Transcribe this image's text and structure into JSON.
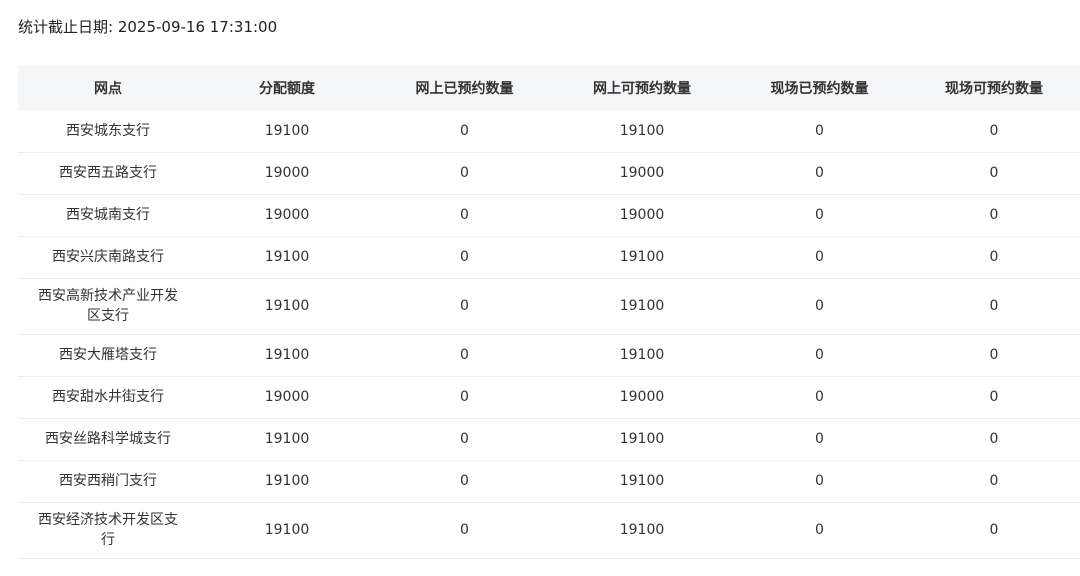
{
  "stat_date_label": "统计截止日期: 2025-09-16 17:31:00",
  "table": {
    "headers": [
      "网点",
      "分配额度",
      "网上已预约数量",
      "网上可预约数量",
      "现场已预约数量",
      "现场可预约数量"
    ],
    "rows": [
      {
        "branch": "西安城东支行",
        "quota": "19100",
        "online_booked": "0",
        "online_available": "19100",
        "onsite_booked": "0",
        "onsite_available": "0"
      },
      {
        "branch": "西安西五路支行",
        "quota": "19000",
        "online_booked": "0",
        "online_available": "19000",
        "onsite_booked": "0",
        "onsite_available": "0"
      },
      {
        "branch": "西安城南支行",
        "quota": "19000",
        "online_booked": "0",
        "online_available": "19000",
        "onsite_booked": "0",
        "onsite_available": "0"
      },
      {
        "branch": "西安兴庆南路支行",
        "quota": "19100",
        "online_booked": "0",
        "online_available": "19100",
        "onsite_booked": "0",
        "onsite_available": "0"
      },
      {
        "branch": "西安高新技术产业开发区支行",
        "quota": "19100",
        "online_booked": "0",
        "online_available": "19100",
        "onsite_booked": "0",
        "onsite_available": "0"
      },
      {
        "branch": "西安大雁塔支行",
        "quota": "19100",
        "online_booked": "0",
        "online_available": "19100",
        "onsite_booked": "0",
        "onsite_available": "0"
      },
      {
        "branch": "西安甜水井街支行",
        "quota": "19000",
        "online_booked": "0",
        "online_available": "19000",
        "onsite_booked": "0",
        "onsite_available": "0"
      },
      {
        "branch": "西安丝路科学城支行",
        "quota": "19100",
        "online_booked": "0",
        "online_available": "19100",
        "onsite_booked": "0",
        "onsite_available": "0"
      },
      {
        "branch": "西安西稍门支行",
        "quota": "19100",
        "online_booked": "0",
        "online_available": "19100",
        "onsite_booked": "0",
        "onsite_available": "0"
      },
      {
        "branch": "西安经济技术开发区支行",
        "quota": "19100",
        "online_booked": "0",
        "online_available": "19100",
        "onsite_booked": "0",
        "onsite_available": "0"
      }
    ]
  }
}
